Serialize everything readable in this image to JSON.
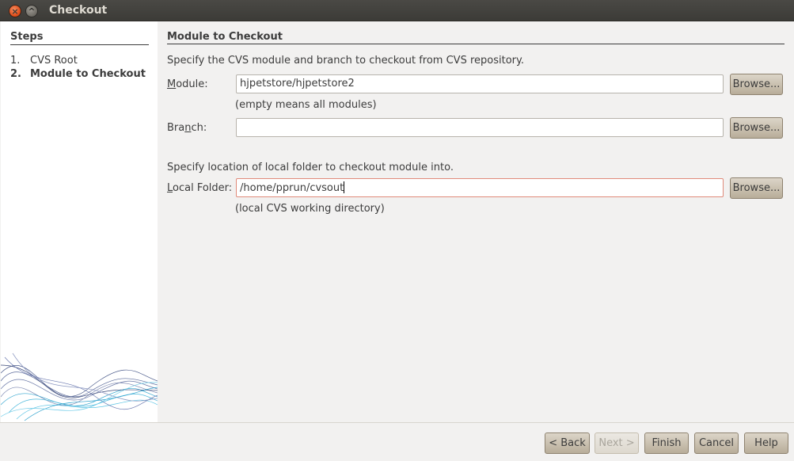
{
  "window": {
    "title": "Checkout"
  },
  "steps": {
    "title": "Steps",
    "items": [
      {
        "num": "1.",
        "label": "CVS Root"
      },
      {
        "num": "2.",
        "label": "Module to Checkout"
      }
    ]
  },
  "main": {
    "title": "Module to Checkout",
    "desc1": "Specify the CVS module and branch to checkout from CVS repository.",
    "module": {
      "label_pre": "",
      "label_mnemonic": "M",
      "label_post": "odule:",
      "value": "hjpetstore/hjpetstore2",
      "hint": "(empty means all modules)",
      "browse": "Browse..."
    },
    "branch": {
      "label_pre": "Bra",
      "label_mnemonic": "n",
      "label_post": "ch:",
      "value": "",
      "browse": "Browse..."
    },
    "desc2": "Specify location of local folder to checkout module into.",
    "folder": {
      "label_pre": "",
      "label_mnemonic": "L",
      "label_post": "ocal Folder:",
      "value": "/home/pprun/cvsout",
      "hint": "(local CVS working directory)",
      "browse": "Browse..."
    }
  },
  "buttons": {
    "back": "< Back",
    "next": "Next >",
    "finish": "Finish",
    "cancel": "Cancel",
    "help": "Help"
  }
}
